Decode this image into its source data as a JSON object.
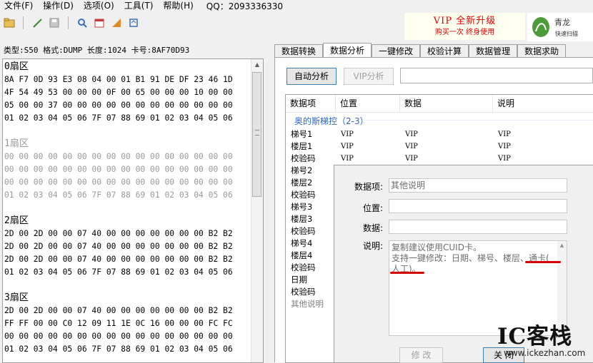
{
  "menu": {
    "items": [
      "文件(F)",
      "操作(D)",
      "选项(O)",
      "工具(T)",
      "帮助(H)"
    ],
    "qq": "QQ：2093336330"
  },
  "toolbar": {
    "icons": [
      "folder-icon",
      "edit-icon",
      "save-icon",
      "search-icon",
      "calendar-icon",
      "chart-icon",
      "refresh-icon"
    ]
  },
  "banner": {
    "title": "VIP 全新升级",
    "subtitle": "购买一次   终身使用",
    "logo_text": "青龙",
    "logo_sub": "快速扫描"
  },
  "info_line": "类型:S50  格式:DUMP  长度:1024  卡号:8AF70D93",
  "hex": {
    "sectors": [
      {
        "title": "0扇区",
        "dim": false,
        "rows": [
          "8A F7 0D 93 E3 08 04 00 01 B1 91 DE DF 23 46 1D",
          "4F 54 49 53 00 00 00 0F 00 65 00 00 00 10 00 00",
          "05 00 00 37 00 00 00 00 00 00 00 00 00 00 00 00",
          "01 02 03 04 05 06 7F 07 88 69 01 02 03 04 05 06"
        ]
      },
      {
        "title": "1扇区",
        "dim": true,
        "rows": [
          "00 00 00 00 00 00 00 00 00 00 00 00 00 00 00 00",
          "00 00 00 00 00 00 00 00 00 00 00 00 00 00 00 00",
          "00 00 00 00 00 00 00 00 00 00 00 00 00 00 00 00",
          "01 02 03 04 05 06 7F 07 88 69 01 02 03 04 05 06"
        ]
      },
      {
        "title": "2扇区",
        "dim": false,
        "rows": [
          "2D 00 2D 00 00 07 40 00 00 00 00 00 00 00 B2 B2",
          "2D 00 2D 00 00 07 40 00 00 00 00 00 00 00 B2 B2",
          "2D 00 2D 00 00 07 40 00 00 00 00 00 00 00 B2 B2",
          "01 02 03 04 05 06 7F 07 88 69 01 02 03 04 05 06"
        ]
      },
      {
        "title": "3扇区",
        "dim": false,
        "rows": [
          "2D 00 2D 00 00 07 40 00 00 00 00 00 00 00 B2 B2",
          "FF FF 00 00 C0 12 09 11 1E 0C 16 00 00 00 FC FC",
          "00 00 00 00 00 00 00 00 00 00 00 00 00 00 00 00",
          "01 02 03 04 05 06 7F 07 88 69 01 02 03 04 05 06"
        ]
      }
    ]
  },
  "tabs": [
    "数据转换",
    "数据分析",
    "一键修改",
    "校验计算",
    "数据管理",
    "数据求助"
  ],
  "active_tab": "数据分析",
  "buttons": {
    "auto_analyze": "自动分析",
    "vip_analyze": "VIP分析"
  },
  "table": {
    "headers": [
      "数据项",
      "位置",
      "数据",
      "说明"
    ],
    "group": "奥的斯梯控（2-3）",
    "rows": [
      {
        "item": "梯号1",
        "pos": "VIP",
        "data": "VIP",
        "desc": "VIP"
      },
      {
        "item": "楼层1",
        "pos": "VIP",
        "data": "VIP",
        "desc": "VIP"
      },
      {
        "item": "校验码",
        "pos": "VIP",
        "data": "VIP",
        "desc": "VIP"
      },
      {
        "item": "梯号2",
        "pos": "",
        "data": "",
        "desc": ""
      },
      {
        "item": "楼层2",
        "pos": "",
        "data": "",
        "desc": ""
      },
      {
        "item": "校验码",
        "pos": "",
        "data": "",
        "desc": ""
      },
      {
        "item": "梯号3",
        "pos": "",
        "data": "",
        "desc": ""
      },
      {
        "item": "楼层3",
        "pos": "",
        "data": "",
        "desc": ""
      },
      {
        "item": "校验码",
        "pos": "",
        "data": "",
        "desc": ""
      },
      {
        "item": "梯号4",
        "pos": "",
        "data": "",
        "desc": ""
      },
      {
        "item": "楼层4",
        "pos": "",
        "data": "",
        "desc": ""
      },
      {
        "item": "校验码",
        "pos": "",
        "data": "",
        "desc": ""
      },
      {
        "item": "日期",
        "pos": "",
        "data": "",
        "desc": ""
      },
      {
        "item": "校验码",
        "pos": "",
        "data": "",
        "desc": ""
      },
      {
        "item": "其他说明",
        "pos": "",
        "data": "",
        "desc": ""
      }
    ]
  },
  "dialog": {
    "label_item": "数据项:",
    "value_item": "其他说明",
    "label_pos": "位置:",
    "value_pos": "",
    "label_data": "数据:",
    "value_data": "",
    "label_desc": "说明:",
    "desc_line1": "复制建议使用CUID卡。",
    "desc_line2": "支持一键修改：日期、梯号、楼层、通卡(",
    "desc_line3": "人工)。",
    "modify": "修 改",
    "close": "关 闭"
  },
  "watermark": {
    "text": "IC客栈",
    "url": "www.ickezhan.com"
  },
  "colors": {
    "accent_red": "#d40000",
    "group_blue": "#3366cc"
  }
}
